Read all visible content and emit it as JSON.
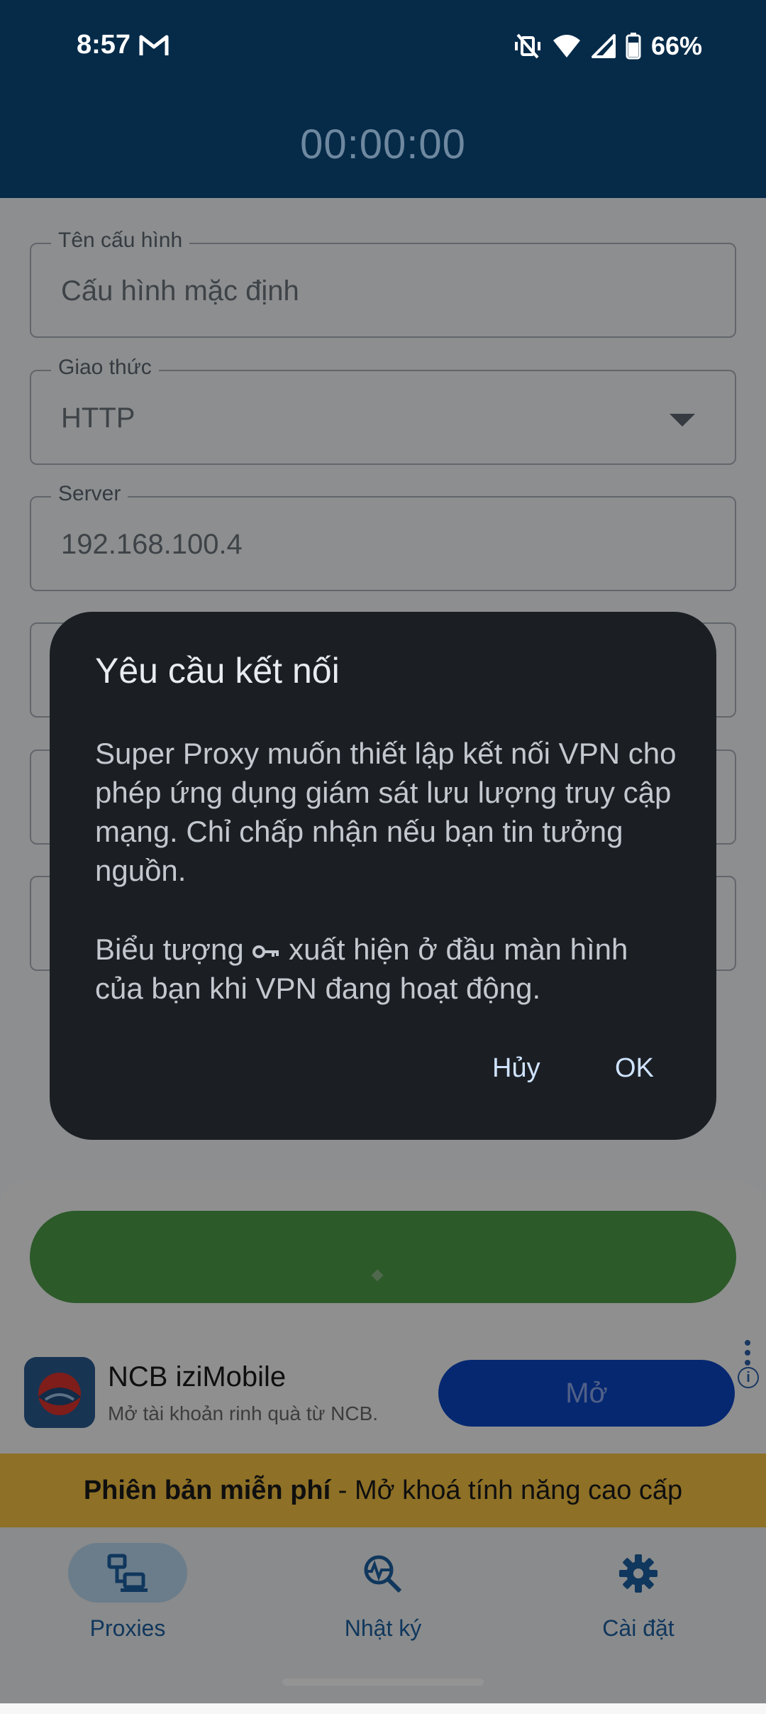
{
  "status_bar": {
    "time": "8:57",
    "battery_pct": "66%"
  },
  "header": {
    "timer": "00:00:00"
  },
  "form": {
    "fields": [
      {
        "label": "Tên cấu hình",
        "value": "Cấu hình mặc định"
      },
      {
        "label": "Giao thức",
        "value": "HTTP"
      },
      {
        "label": "Server",
        "value": "192.168.100.4"
      }
    ]
  },
  "ad": {
    "title": "NCB iziMobile",
    "subtitle": "Mở tài khoản rinh quà từ NCB.",
    "button": "Mở"
  },
  "premium": {
    "bold": "Phiên bản miễn phí",
    "rest": " - Mở khoá tính năng cao cấp"
  },
  "nav": {
    "items": [
      {
        "label": "Proxies",
        "active": true
      },
      {
        "label": "Nhật ký",
        "active": false
      },
      {
        "label": "Cài đặt",
        "active": false
      }
    ]
  },
  "dialog": {
    "title": "Yêu cầu kết nối",
    "body": "Super Proxy muốn thiết lập kết nối VPN cho phép ứng dụng giám sát lưu lượng truy cập mạng. Chỉ chấp nhận nếu bạn tin tưởng nguồn.",
    "body2_a": "Biểu tượng ",
    "body2_b": " xuất hiện ở đầu màn hình của bạn khi VPN đang hoạt động.",
    "cancel": "Hủy",
    "ok": "OK"
  },
  "colors": {
    "accent": "#1c5fa0",
    "connect": "#4d9c48",
    "premium": "#f4c242",
    "appbar": "#062b49"
  }
}
